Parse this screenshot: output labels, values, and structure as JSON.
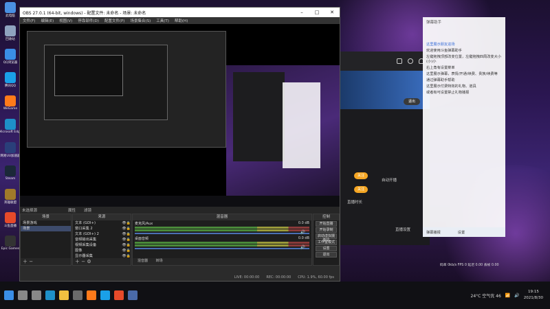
{
  "desktop": {
    "icons": [
      {
        "label": "此电脑",
        "icon": "computer-icon",
        "color": "#4a90e2"
      },
      {
        "label": "回收站",
        "icon": "recycle-bin-icon",
        "color": "#8fa3bf"
      },
      {
        "label": "QQ浏览器",
        "icon": "qq-browser-icon",
        "color": "#3a8ee6"
      },
      {
        "label": "腾讯QQ",
        "icon": "qq-icon",
        "color": "#1aa0e8"
      },
      {
        "label": "WeGame",
        "icon": "wegame-icon",
        "color": "#ff7a1a"
      },
      {
        "label": "Microsoft Edge",
        "icon": "edge-icon",
        "color": "#1e90c8"
      },
      {
        "label": "网易UU加速器",
        "icon": "uu-icon",
        "color": "#2a3f7a"
      },
      {
        "label": "Steam",
        "icon": "steam-icon",
        "color": "#1b2838"
      },
      {
        "label": "英雄联盟",
        "icon": "lol-icon",
        "color": "#a07a2a"
      },
      {
        "label": "斗鱼直播",
        "icon": "douyu-icon",
        "color": "#e64a2a"
      },
      {
        "label": "Epic Games",
        "icon": "epic-icon",
        "color": "#333333"
      }
    ]
  },
  "obs": {
    "title": "OBS 27.0.1 (64-bit, windows) - 配置文件: 未命名 - 场景: 未命名",
    "menu": [
      "文件(F)",
      "编辑(E)",
      "视图(V)",
      "停靠部件(D)",
      "配置文件(P)",
      "场景集合(S)",
      "工具(T)",
      "帮助(H)"
    ],
    "selected_source_hint": "未选择源",
    "dock_headers": {
      "scenes": "场景",
      "sources": "来源",
      "mixer": "混音器",
      "transitions": "场景转场",
      "controls": "控制"
    },
    "props_label": "属性",
    "filters_label": "滤镜",
    "scenes": [
      "场景游戏",
      "场景"
    ],
    "sources": [
      "文本 (GDI+)",
      "窗口采集 2",
      "文本 (GDI+) 2",
      "音频输出采集",
      "视频采集设备",
      "图像",
      "显示器采集",
      "窗口采集",
      "浏览器",
      "窗口采集 3"
    ],
    "mixer": [
      {
        "name": "麦克风/Aux",
        "db": "0.0 dB"
      },
      {
        "name": "桌面音频",
        "db": "0.0 dB"
      }
    ],
    "controls": [
      "开始直播",
      "开始录制",
      "启动虚拟摄像机",
      "工作室模式",
      "设置",
      "退出"
    ],
    "status": {
      "live": "LIVE: 00:00:00",
      "rec": "REC: 00:00:00",
      "cpu": "CPU: 1.9%, 60.00 fps"
    },
    "tabs": [
      "混音器",
      "转场"
    ]
  },
  "app": {
    "exit_label": "退出",
    "btn1": "关注",
    "btn2": "关注",
    "item1": "自动开播",
    "item2": "直播时长",
    "bottom": "直播设置"
  },
  "chat": {
    "title": "弹幕助手",
    "lines": [
      {
        "text": "这里展示朋友进场",
        "hl": true
      },
      {
        "text": "欢迎使用斗鱼弹幕助手",
        "hl": false
      },
      {
        "text": "左键拖拽顶部改变位置，左键拖拽四周改变大小(小)小",
        "hl": false
      },
      {
        "text": "右上角有设置菜单",
        "hl": false
      },
      {
        "text": "这里展示弹幕，表情/开通/续费、贵族/续费等",
        "hl": false
      },
      {
        "text": "通过弹幕助手帮助",
        "hl": false
      },
      {
        "text": "这里展示付费特效的礼物、道具",
        "hl": false
      },
      {
        "text": "或者有可设置禁止礼物播报",
        "hl": false
      }
    ],
    "bottom_left": "弹幕播报",
    "bottom_right": "设置"
  },
  "stats": "码率 0kb/s  FPS 0  延迟 0.00  丢帧 0.00",
  "taskbar": {
    "icons": [
      {
        "icon": "windows-start-icon",
        "color": "#3a8ee6"
      },
      {
        "icon": "search-icon",
        "color": "#888888"
      },
      {
        "icon": "task-view-icon",
        "color": "#888888"
      },
      {
        "icon": "edge-icon",
        "color": "#1e90c8"
      },
      {
        "icon": "file-explorer-icon",
        "color": "#f0c040"
      },
      {
        "icon": "obs-icon",
        "color": "#6a6a6a"
      },
      {
        "icon": "wegame-icon",
        "color": "#ff7a1a"
      },
      {
        "icon": "qq-icon",
        "color": "#1aa0e8"
      },
      {
        "icon": "douyu-icon",
        "color": "#e64a2a"
      },
      {
        "icon": "steam-icon",
        "color": "#4a6aa8"
      }
    ],
    "weather": "24°C 空气优 46",
    "time": "19:15",
    "date": "2021/8/30"
  }
}
